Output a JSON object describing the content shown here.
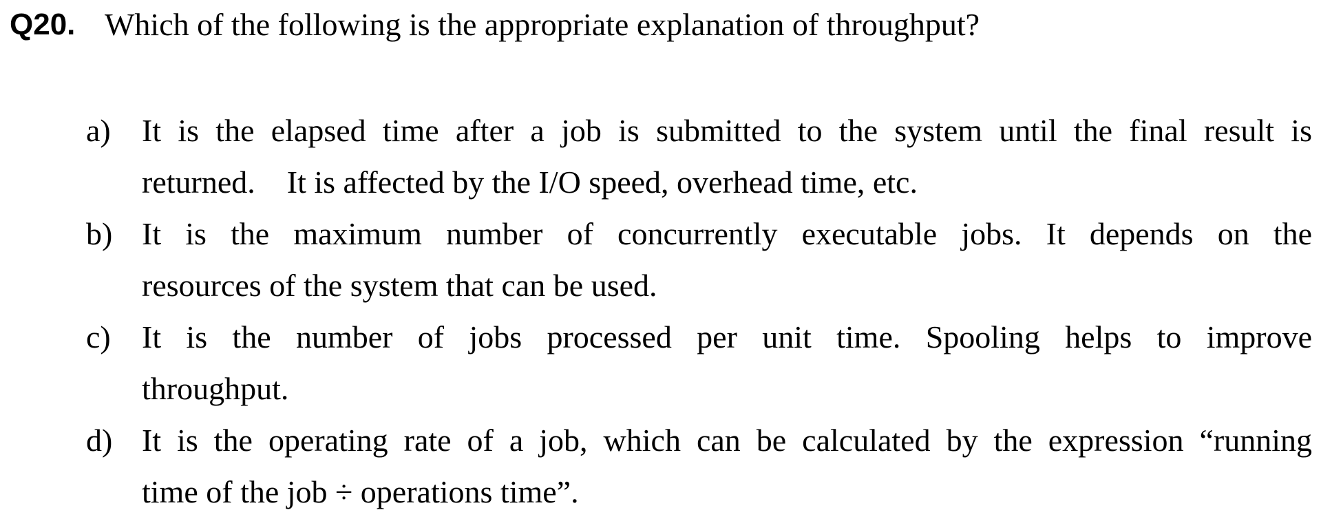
{
  "question": {
    "number": "Q20.",
    "text": "Which of the following is the appropriate explanation of throughput?"
  },
  "options": [
    {
      "label": "a)",
      "line1": "It is the elapsed time after a job is submitted to the system until the final result is",
      "line2": "returned.    It is affected by the I/O speed, overhead time, etc."
    },
    {
      "label": "b)",
      "line1": "It is the maximum number of concurrently executable jobs.   It depends on the",
      "line2": "resources of the system that can be used."
    },
    {
      "label": "c)",
      "line1": "It is the number of jobs processed per unit time.   Spooling helps to improve",
      "line2": "throughput."
    },
    {
      "label": "d)",
      "line1": "It is the operating rate of a job, which can be calculated by the expression “running",
      "line2": "time of the job ÷ operations time”."
    }
  ]
}
